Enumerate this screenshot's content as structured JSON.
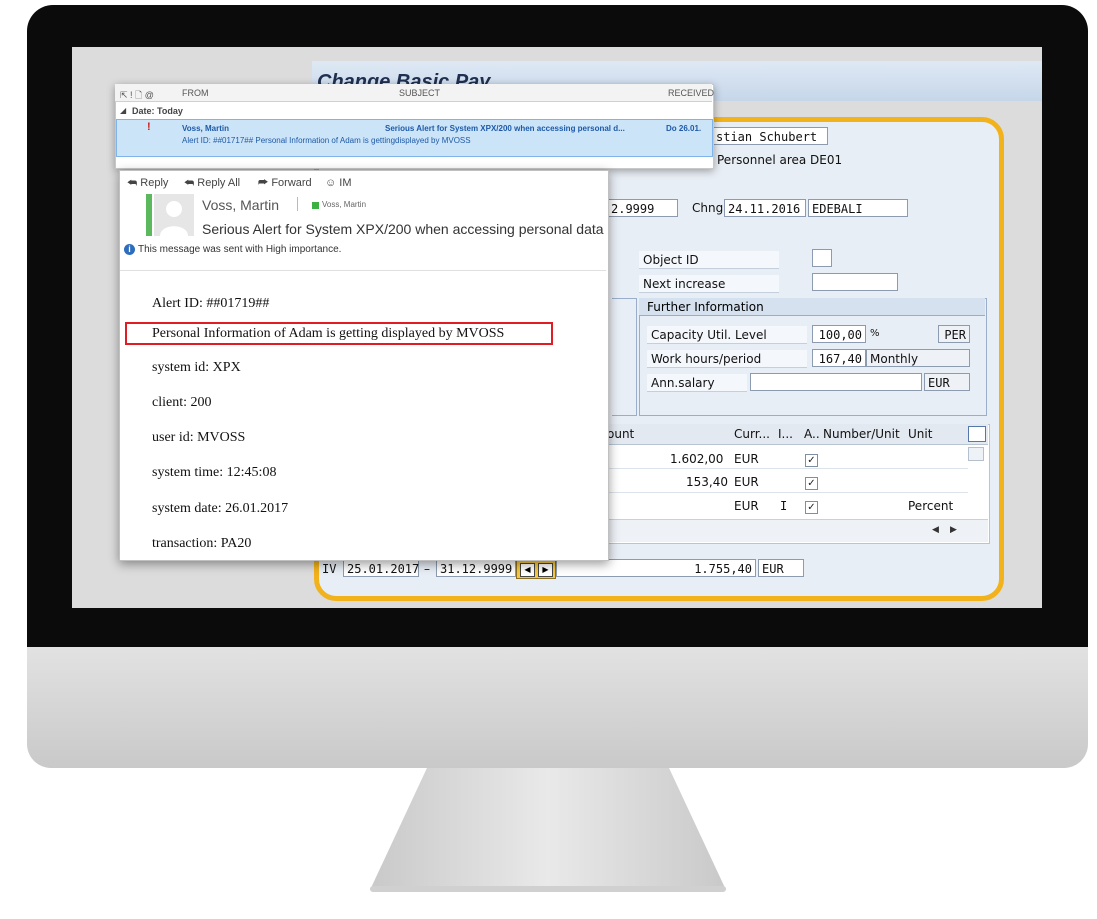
{
  "sap": {
    "title": "Change Basic Pay",
    "name_value": "stian Schubert",
    "personnel_area": "Personnel area DE01",
    "end_date_fragment": "2.9999",
    "chng_label": "Chng",
    "chng_date": "24.11.2016",
    "chng_user": "EDEBALI",
    "object_id_label": "Object ID",
    "next_increase_label": "Next increase",
    "further_info": {
      "title": "Further Information",
      "capacity_label": "Capacity Util. Level",
      "capacity_value": "100,00",
      "capacity_unit": "%",
      "capacity_code": "PER",
      "work_hours_label": "Work hours/period",
      "work_hours_value": "167,40",
      "work_hours_period": "Monthly",
      "ann_salary_label": "Ann.salary",
      "ann_salary_currency": "EUR"
    },
    "table": {
      "headers": [
        "ount",
        "Curr...",
        "I...",
        "A..",
        "Number/Unit",
        "Unit"
      ],
      "rows": [
        {
          "amount": "1.602,00",
          "currency": "EUR",
          "ind": "",
          "checked": "✓",
          "unit": ""
        },
        {
          "amount": "153,40",
          "currency": "EUR",
          "ind": "",
          "checked": "✓",
          "unit": ""
        },
        {
          "amount": "",
          "currency": "EUR",
          "ind": "I",
          "checked": "✓",
          "unit": "Percent"
        }
      ]
    },
    "footer": {
      "type": "IV",
      "from": "25.01.2017",
      "dash": "–",
      "to": "31.12.9999",
      "total": "1.755,40",
      "currency": "EUR"
    }
  },
  "outlook": {
    "list_headers": {
      "icons": "⇱ ! 🗋 @",
      "from": "FROM",
      "subject": "SUBJECT",
      "received": "RECEIVED"
    },
    "group_label": "Date: Today",
    "message": {
      "importance": "!",
      "from": "Voss, Martin",
      "subject": "Serious Alert for System XPX/200 when accessing personal d...",
      "received": "Do 26.01.",
      "preview": "Alert ID: ##01717##   Personal Information of Adam is gettingdisplayed by MVOSS"
    },
    "reading": {
      "reply": "Reply",
      "reply_all": "Reply All",
      "forward": "Forward",
      "im": "IM",
      "sender_name": "Voss, Martin",
      "sender_status": "Voss, Martin",
      "subject": "Serious Alert for System XPX/200 when accessing personal data",
      "importance_note": "This message was sent with High importance.",
      "body": [
        "Alert ID: ##01719##",
        "Personal Information of Adam is getting displayed by MVOSS",
        "system id: XPX",
        "client: 200",
        "user id: MVOSS",
        "system time: 12:45:08",
        "system date: 26.01.2017",
        "transaction: PA20"
      ]
    }
  },
  "colors": {
    "highlight_red": "#e01c24",
    "panel_orange": "#f2b21b",
    "outlook_blue": "#1e5aa8"
  }
}
